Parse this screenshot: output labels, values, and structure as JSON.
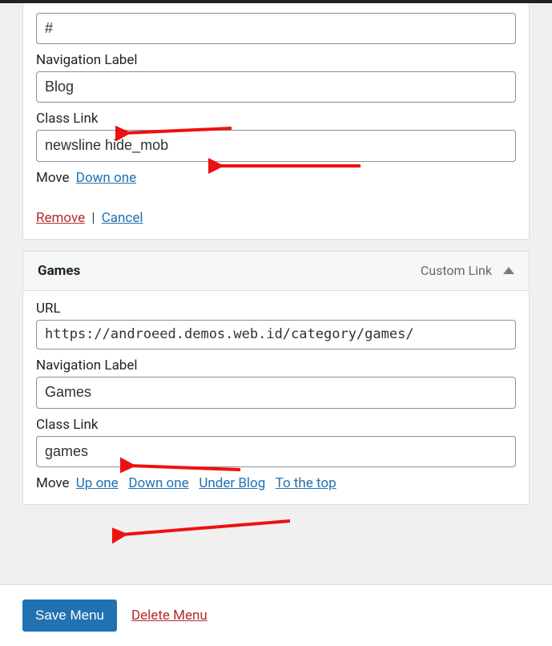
{
  "item1": {
    "url_value": "#",
    "nav_label_title": "Navigation Label",
    "nav_label_value": "Blog",
    "class_link_title": "Class Link",
    "class_link_value": "newsline hide_mob",
    "move_label": "Move",
    "move_down": "Down one",
    "remove": "Remove",
    "sep": "|",
    "cancel": "Cancel"
  },
  "item2": {
    "header_title": "Games",
    "header_type": "Custom Link",
    "url_title": "URL",
    "url_value": "https://androeed.demos.web.id/category/games/",
    "nav_label_title": "Navigation Label",
    "nav_label_value": "Games",
    "class_link_title": "Class Link",
    "class_link_value": "games",
    "move_label": "Move",
    "move_up": "Up one",
    "move_down": "Down one",
    "move_under": "Under Blog",
    "move_top": "To the top"
  },
  "footer": {
    "save": "Save Menu",
    "delete": "Delete Menu"
  }
}
